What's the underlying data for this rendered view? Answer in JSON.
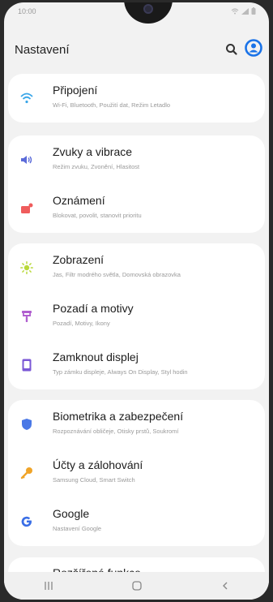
{
  "status": {
    "time": "10:00"
  },
  "header": {
    "title": "Nastavení"
  },
  "colors": {
    "accent": "#1a73e8",
    "wifi": "#3aa6e8",
    "sound": "#5b6bd9",
    "notify": "#ef5c5c",
    "display": "#b8d83a",
    "wallpaper": "#b05fcf",
    "lock": "#7b58d6",
    "bio": "#4a78e6",
    "accounts": "#f0a428",
    "google": "#3a6ee6"
  },
  "groups": [
    [
      {
        "icon": "wifi-icon",
        "title": "Připojení",
        "subtitle": "Wi-Fi, Bluetooth, Použití dat, Režim Letadlo"
      }
    ],
    [
      {
        "icon": "speaker-icon",
        "title": "Zvuky a vibrace",
        "subtitle": "Režim zvuku, Zvonění, Hlasitost"
      },
      {
        "icon": "notification-icon",
        "title": "Oznámení",
        "subtitle": "Blokovat, povolit, stanovit prioritu"
      }
    ],
    [
      {
        "icon": "brightness-icon",
        "title": "Zobrazení",
        "subtitle": "Jas, Filtr modrého světla, Domovská obrazovka"
      },
      {
        "icon": "brush-icon",
        "title": "Pozadí a motivy",
        "subtitle": "Pozadí, Motivy, Ikony"
      },
      {
        "icon": "lock-screen-icon",
        "title": "Zamknout displej",
        "subtitle": "Typ zámku displeje, Always On Display, Styl hodin"
      }
    ],
    [
      {
        "icon": "shield-icon",
        "title": "Biometrika a zabezpečení",
        "subtitle": "Rozpoznávání obličeje, Otisky prstů, Soukromí"
      },
      {
        "icon": "key-icon",
        "title": "Účty a zálohování",
        "subtitle": "Samsung Cloud, Smart Switch"
      },
      {
        "icon": "google-icon",
        "title": "Google",
        "subtitle": "Nastavení Google"
      }
    ],
    [
      {
        "icon": "advanced-icon",
        "title": "Rozšířené funkce",
        "subtitle": ""
      }
    ]
  ],
  "nav": {
    "recents": "recents-icon",
    "home": "home-icon",
    "back": "back-icon"
  }
}
